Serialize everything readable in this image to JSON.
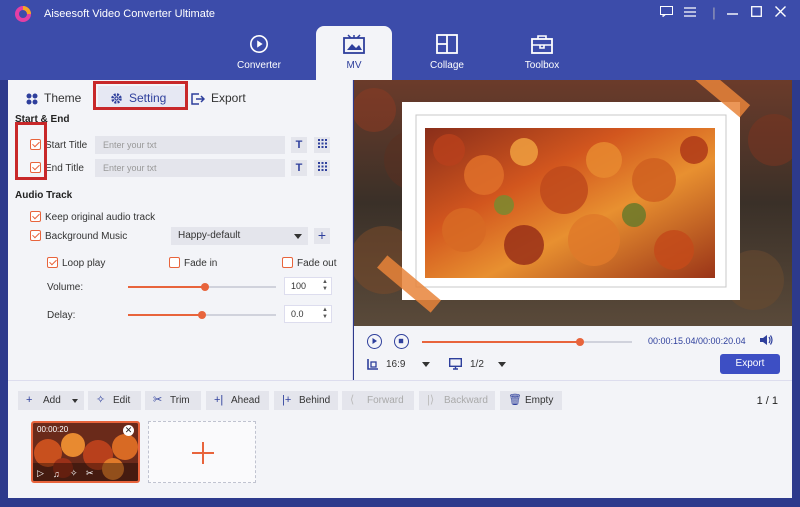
{
  "app": {
    "title": "Aiseesoft Video Converter Ultimate"
  },
  "nav": {
    "tabs": [
      {
        "label": "Converter"
      },
      {
        "label": "MV"
      },
      {
        "label": "Collage"
      },
      {
        "label": "Toolbox"
      }
    ],
    "active": "MV"
  },
  "subtabs": [
    {
      "label": "Theme"
    },
    {
      "label": "Setting"
    },
    {
      "label": "Export"
    }
  ],
  "start_end": {
    "section_label": "Start & End",
    "start_title": {
      "label": "Start Title",
      "checked": true,
      "placeholder": "Enter your txt"
    },
    "end_title": {
      "label": "End Title",
      "checked": true,
      "placeholder": "Enter your txt"
    },
    "text_icon": "T"
  },
  "audio": {
    "section_label": "Audio Track",
    "keep_original": {
      "label": "Keep original audio track",
      "checked": true
    },
    "background_music": {
      "label": "Background Music",
      "checked": true,
      "selected": "Happy-default"
    },
    "loop_play": {
      "label": "Loop play",
      "checked": true
    },
    "fade_in": {
      "label": "Fade in",
      "checked": false
    },
    "fade_out": {
      "label": "Fade out",
      "checked": false
    },
    "volume": {
      "label": "Volume:",
      "value": "100",
      "level": 0.52
    },
    "delay": {
      "label": "Delay:",
      "value": "0.0",
      "level": 0.5
    }
  },
  "player": {
    "time": "00:00:15.04/00:00:20.04",
    "progress": 0.75,
    "aspect": "16:9",
    "quality": "1/2",
    "export_label": "Export"
  },
  "toolbar": {
    "add": "Add",
    "edit": "Edit",
    "trim": "Trim",
    "ahead": "Ahead",
    "behind": "Behind",
    "forward": "Forward",
    "backward": "Backward",
    "empty": "Empty",
    "page": "1 / 1"
  },
  "clip": {
    "duration": "00:00:20"
  },
  "colors": {
    "accent": "#e8643c",
    "brand": "#3c4caa",
    "highlight": "#c8282a"
  }
}
